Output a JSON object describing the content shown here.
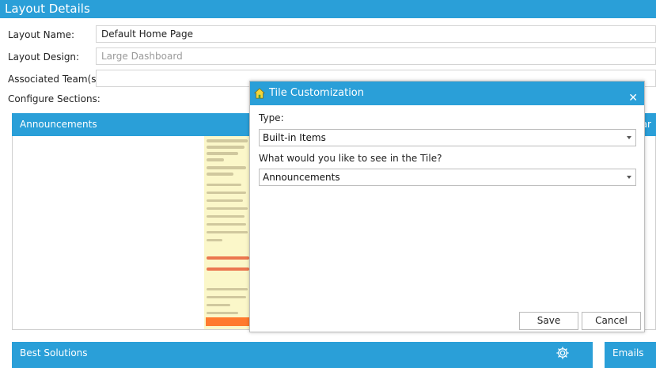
{
  "header": {
    "title": "Layout Details"
  },
  "form": {
    "layout_name_label": "Layout Name:",
    "layout_name_value": "Default Home Page",
    "layout_design_label": "Layout Design:",
    "layout_design_value": "Large Dashboard",
    "teams_label": "Associated Team(s):",
    "teams_value": "",
    "configure_label": "Configure Sections:"
  },
  "sections": {
    "announcements": "Announcements",
    "right_partial": "ar",
    "best_solutions": "Best Solutions",
    "emails": "Emails"
  },
  "modal": {
    "title": "Tile Customization",
    "close": "✕",
    "type_label": "Type:",
    "type_value": "Built-in Items",
    "tile_label": "What would you like to see in the Tile?",
    "tile_value": "Announcements",
    "save": "Save",
    "cancel": "Cancel"
  },
  "icons": {
    "modal_icon": "home-icon",
    "settings": "gear-icon",
    "close": "close-icon"
  },
  "colors": {
    "accent": "#2a9fd8",
    "highlight": "#fbf7c9",
    "orange": "#ff7a2e"
  }
}
